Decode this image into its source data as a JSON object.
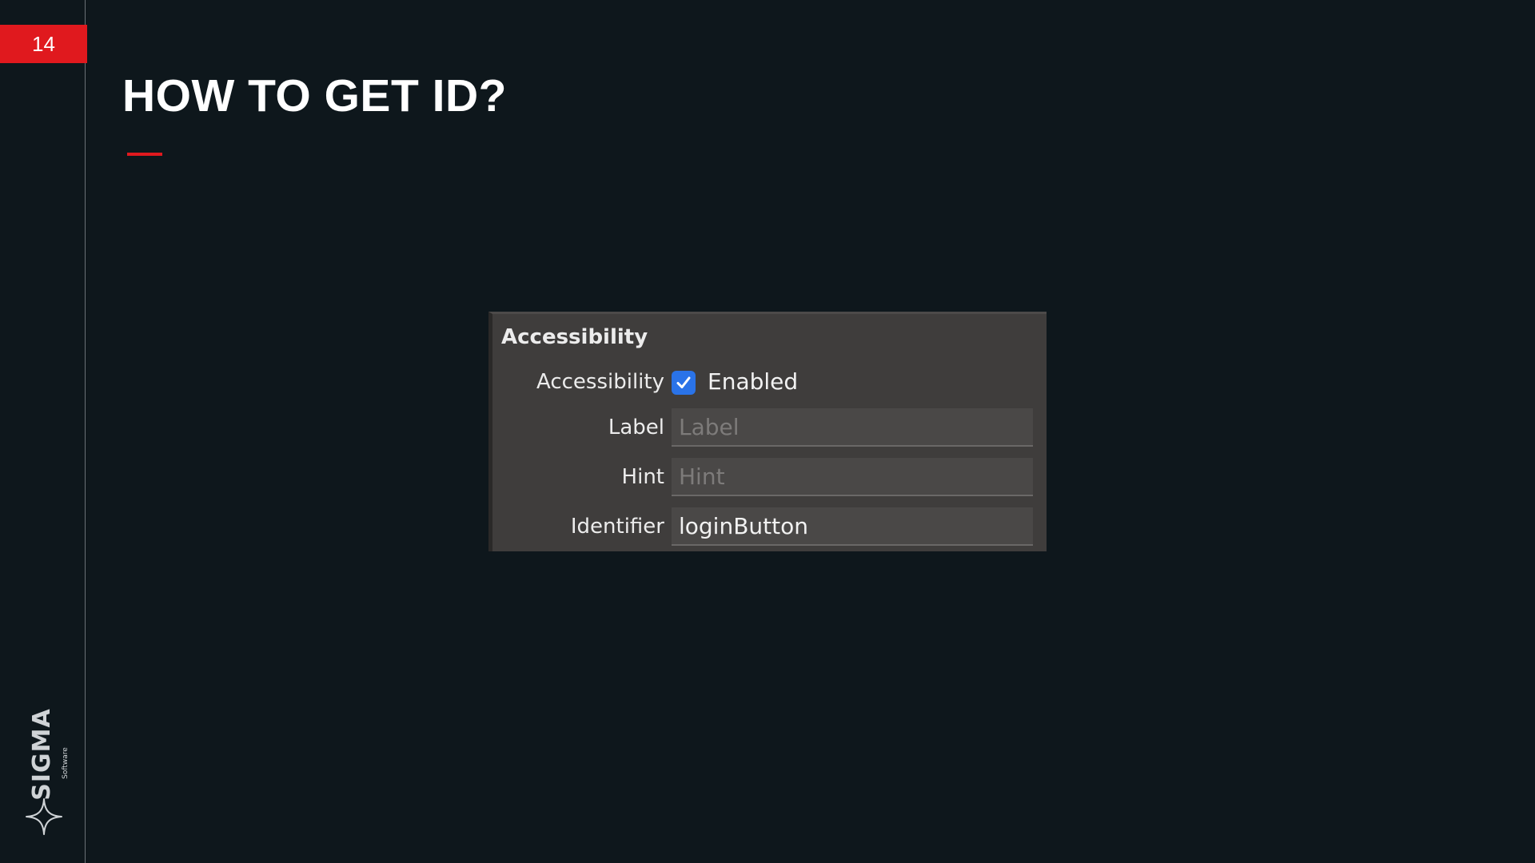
{
  "slide": {
    "number": "14",
    "title": "HOW TO GET ID?"
  },
  "logo": {
    "name": "SIGMA",
    "subtitle": "Software"
  },
  "panel": {
    "header": "Accessibility",
    "accessibility": {
      "label": "Accessibility",
      "checkbox_text": "Enabled",
      "checked": true
    },
    "label_field": {
      "label": "Label",
      "placeholder": "Label",
      "value": ""
    },
    "hint_field": {
      "label": "Hint",
      "placeholder": "Hint",
      "value": ""
    },
    "identifier_field": {
      "label": "Identifier",
      "placeholder": "",
      "value": "loginButton"
    }
  },
  "colors": {
    "background": "#0e171c",
    "accent": "#e0191e",
    "panel": "#3f3d3c",
    "checkbox": "#2a73e8"
  }
}
